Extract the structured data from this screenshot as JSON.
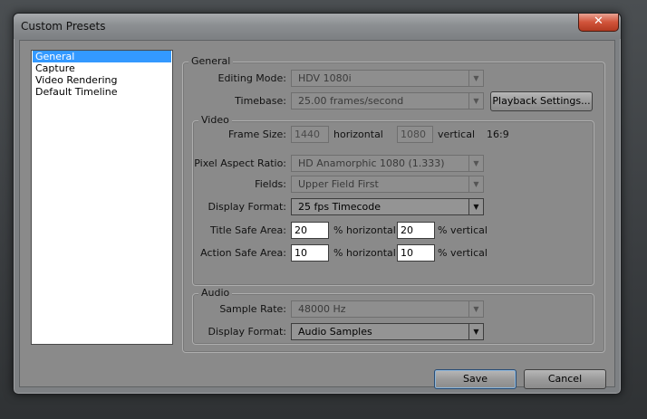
{
  "window": {
    "title": "Custom Presets",
    "close_glyph": "✕"
  },
  "sidebar": {
    "items": [
      {
        "label": "General",
        "selected": true
      },
      {
        "label": "Capture",
        "selected": false
      },
      {
        "label": "Video Rendering",
        "selected": false
      },
      {
        "label": "Default Timeline",
        "selected": false
      }
    ]
  },
  "general": {
    "group_label": "General",
    "editing_mode": {
      "label": "Editing Mode:",
      "value": "HDV 1080i"
    },
    "timebase": {
      "label": "Timebase:",
      "value": "25.00 frames/second"
    },
    "playback_settings_label": "Playback Settings..."
  },
  "video": {
    "group_label": "Video",
    "frame_size": {
      "label": "Frame Size:",
      "horizontal_value": "1440",
      "horizontal_label": "horizontal",
      "vertical_value": "1080",
      "vertical_label": "vertical",
      "aspect": "16:9"
    },
    "pixel_aspect": {
      "label": "Pixel Aspect Ratio:",
      "value": "HD Anamorphic 1080 (1.333)"
    },
    "fields": {
      "label": "Fields:",
      "value": "Upper Field First"
    },
    "display_format": {
      "label": "Display Format:",
      "value": "25 fps Timecode"
    },
    "title_safe": {
      "label": "Title Safe Area:",
      "horizontal_value": "20",
      "horizontal_label": "% horizontal",
      "vertical_value": "20",
      "vertical_label": "% vertical"
    },
    "action_safe": {
      "label": "Action Safe Area:",
      "horizontal_value": "10",
      "horizontal_label": "% horizontal",
      "vertical_value": "10",
      "vertical_label": "% vertical"
    }
  },
  "audio": {
    "group_label": "Audio",
    "sample_rate": {
      "label": "Sample Rate:",
      "value": "48000 Hz"
    },
    "display_format": {
      "label": "Display Format:",
      "value": "Audio Samples"
    }
  },
  "buttons": {
    "save": "Save",
    "cancel": "Cancel"
  },
  "icons": {
    "dropdown_arrow": "▼"
  },
  "colors": {
    "selection": "#3399ff",
    "close_button": "#d1543a"
  }
}
